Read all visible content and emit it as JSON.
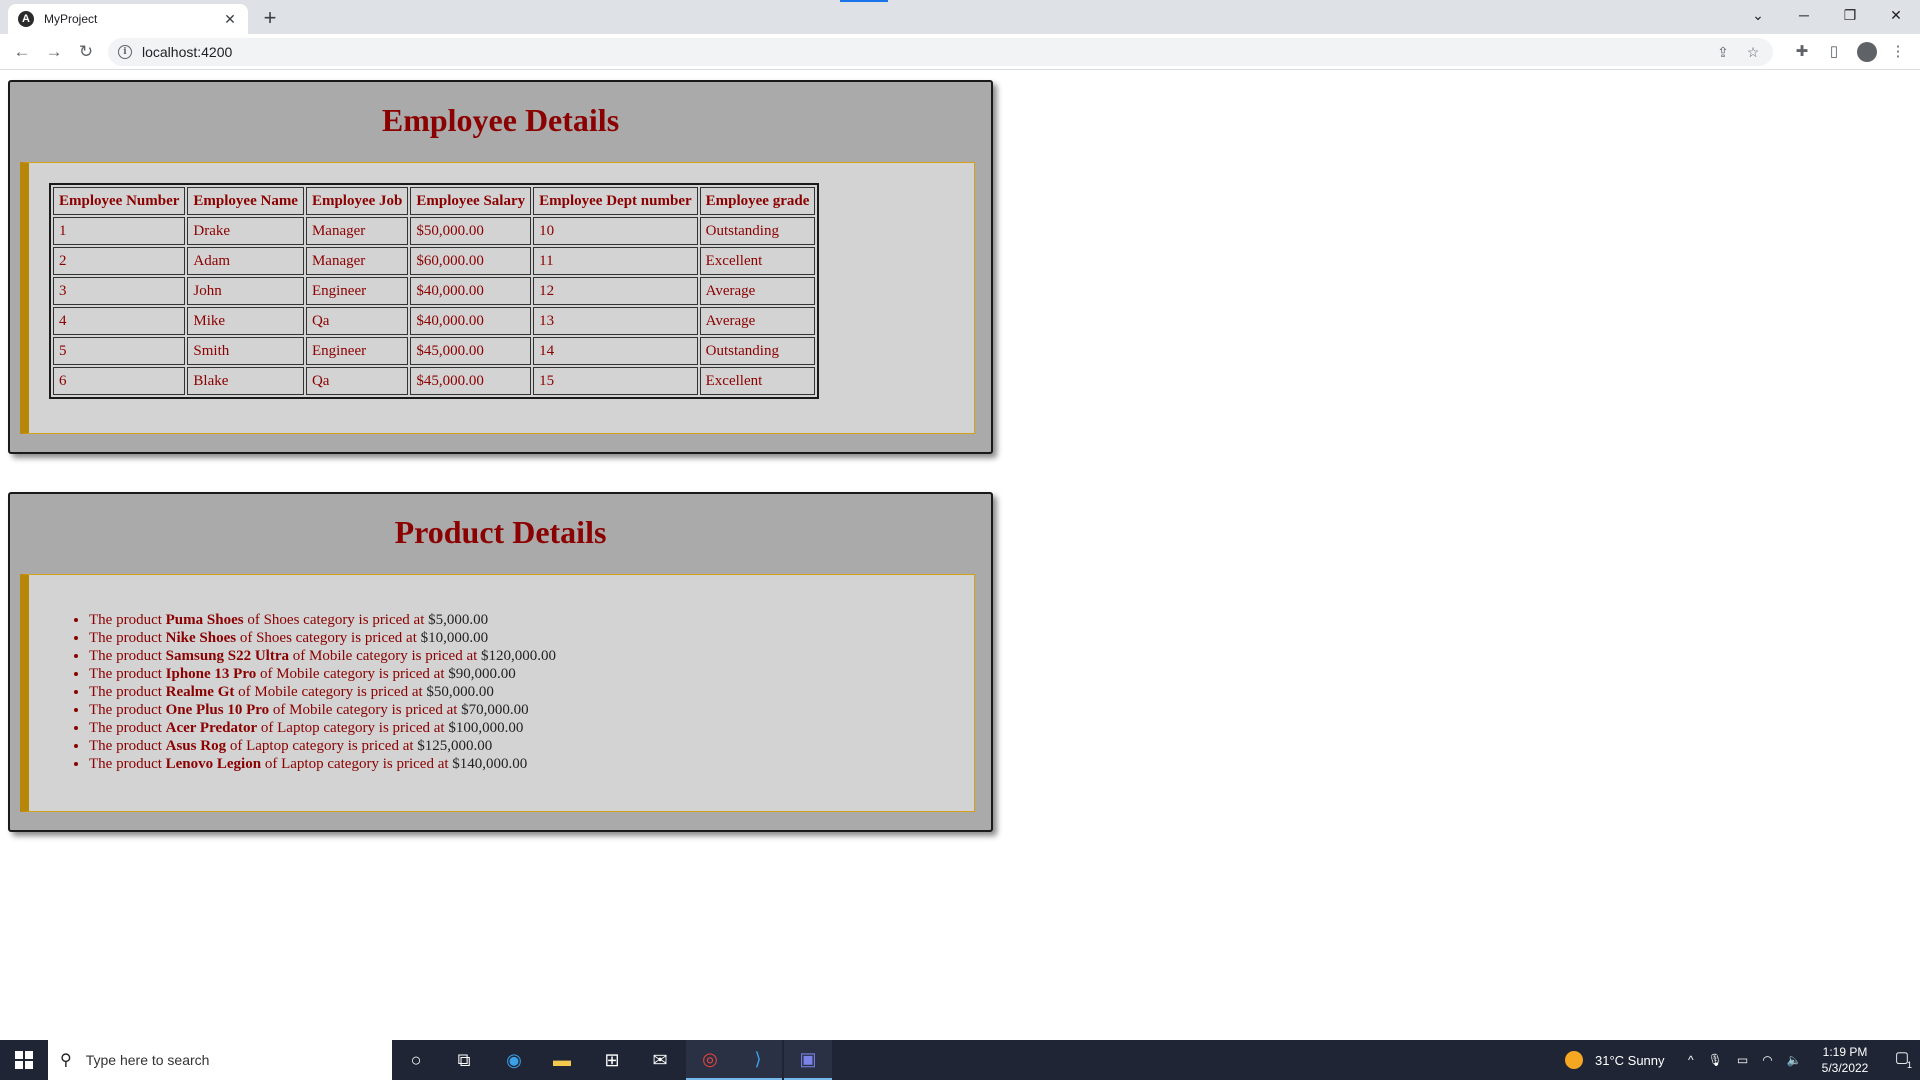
{
  "browser": {
    "tab_title": "MyProject",
    "url": "localhost:4200"
  },
  "employee_section": {
    "title": "Employee Details",
    "headers": [
      "Employee Number",
      "Employee Name",
      "Employee Job",
      "Employee Salary",
      "Employee Dept number",
      "Employee grade"
    ],
    "rows": [
      [
        "1",
        "Drake",
        "Manager",
        "$50,000.00",
        "10",
        "Outstanding"
      ],
      [
        "2",
        "Adam",
        "Manager",
        "$60,000.00",
        "11",
        "Excellent"
      ],
      [
        "3",
        "John",
        "Engineer",
        "$40,000.00",
        "12",
        "Average"
      ],
      [
        "4",
        "Mike",
        "Qa",
        "$40,000.00",
        "13",
        "Average"
      ],
      [
        "5",
        "Smith",
        "Engineer",
        "$45,000.00",
        "14",
        "Outstanding"
      ],
      [
        "6",
        "Blake",
        "Qa",
        "$45,000.00",
        "15",
        "Excellent"
      ]
    ]
  },
  "product_section": {
    "title": "Product Details",
    "text": {
      "prefix": "The product",
      "of": "of",
      "middle": "category is priced at"
    },
    "items": [
      {
        "name": "Puma Shoes",
        "category": "Shoes",
        "price": "$5,000.00"
      },
      {
        "name": "Nike Shoes",
        "category": "Shoes",
        "price": "$10,000.00"
      },
      {
        "name": "Samsung S22 Ultra",
        "category": "Mobile",
        "price": "$120,000.00"
      },
      {
        "name": "Iphone 13 Pro",
        "category": "Mobile",
        "price": "$90,000.00"
      },
      {
        "name": "Realme Gt",
        "category": "Mobile",
        "price": "$50,000.00"
      },
      {
        "name": "One Plus 10 Pro",
        "category": "Mobile",
        "price": "$70,000.00"
      },
      {
        "name": "Acer Predator",
        "category": "Laptop",
        "price": "$100,000.00"
      },
      {
        "name": "Asus Rog",
        "category": "Laptop",
        "price": "$125,000.00"
      },
      {
        "name": "Lenovo Legion",
        "category": "Laptop",
        "price": "$140,000.00"
      }
    ]
  },
  "taskbar": {
    "search_placeholder": "Type here to search",
    "weather": "31°C  Sunny",
    "time": "1:19 PM",
    "date": "5/3/2022",
    "notification_count": "1"
  },
  "icons": {
    "tab_favicon": "angular-icon",
    "start": "windows-logo-icon",
    "apps": [
      "cortana-icon",
      "task-view-icon",
      "edge-icon",
      "file-explorer-icon",
      "store-icon",
      "mail-icon",
      "chrome-icon",
      "vscode-icon",
      "teams-icon"
    ]
  },
  "colors": {
    "heading": "#8b0000",
    "panel_bg": "#aaaaaa",
    "inner_bg": "#d3d3d3",
    "accent_border": "#b8860b"
  }
}
